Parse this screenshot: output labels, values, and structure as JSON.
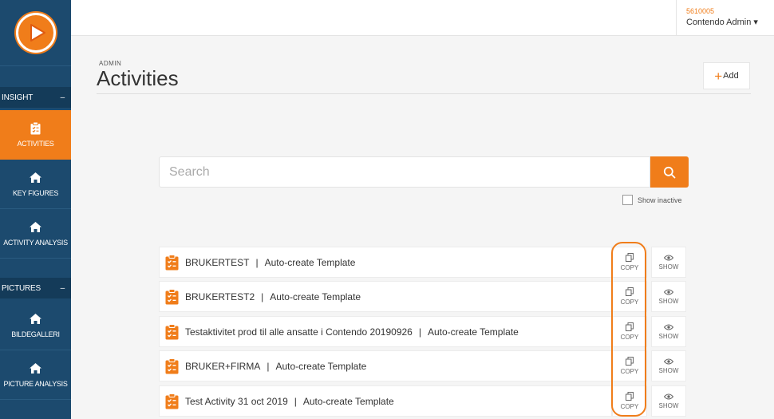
{
  "sidebar": {
    "sections": [
      {
        "label": "INSIGHT",
        "toggle": "–"
      },
      {
        "label": "PICTURES",
        "toggle": "–"
      }
    ],
    "items": [
      {
        "label": "ACTIVITIES",
        "icon": "clipboard-icon"
      },
      {
        "label": "KEY FIGURES",
        "icon": "home-icon"
      },
      {
        "label": "ACTIVITY ANALYSIS",
        "icon": "home-icon"
      },
      {
        "label": "BILDEGALLERI",
        "icon": "home-icon"
      },
      {
        "label": "PICTURE ANALYSIS",
        "icon": "home-icon"
      }
    ]
  },
  "user": {
    "id": "5610005",
    "name": "Contendo Admin ▾"
  },
  "header": {
    "breadcrumb": "ADMIN",
    "title": "Activities",
    "add_label": "Add"
  },
  "search": {
    "placeholder": "Search",
    "show_inactive": "Show inactive"
  },
  "activities": [
    {
      "name": "BRUKERTEST",
      "template": "Auto-create Template"
    },
    {
      "name": "BRUKERTEST2",
      "template": "Auto-create Template"
    },
    {
      "name": "Testaktivitet prod til alle ansatte i Contendo 20190926",
      "template": "Auto-create Template"
    },
    {
      "name": "BRUKER+FIRMA",
      "template": "Auto-create Template"
    },
    {
      "name": "Test Activity 31 oct 2019",
      "template": "Auto-create Template"
    }
  ],
  "actions": {
    "copy": "COPY",
    "show": "SHOW"
  },
  "separator": "|",
  "colors": {
    "accent": "#f07d1a",
    "sidebar": "#1c4a6e"
  }
}
